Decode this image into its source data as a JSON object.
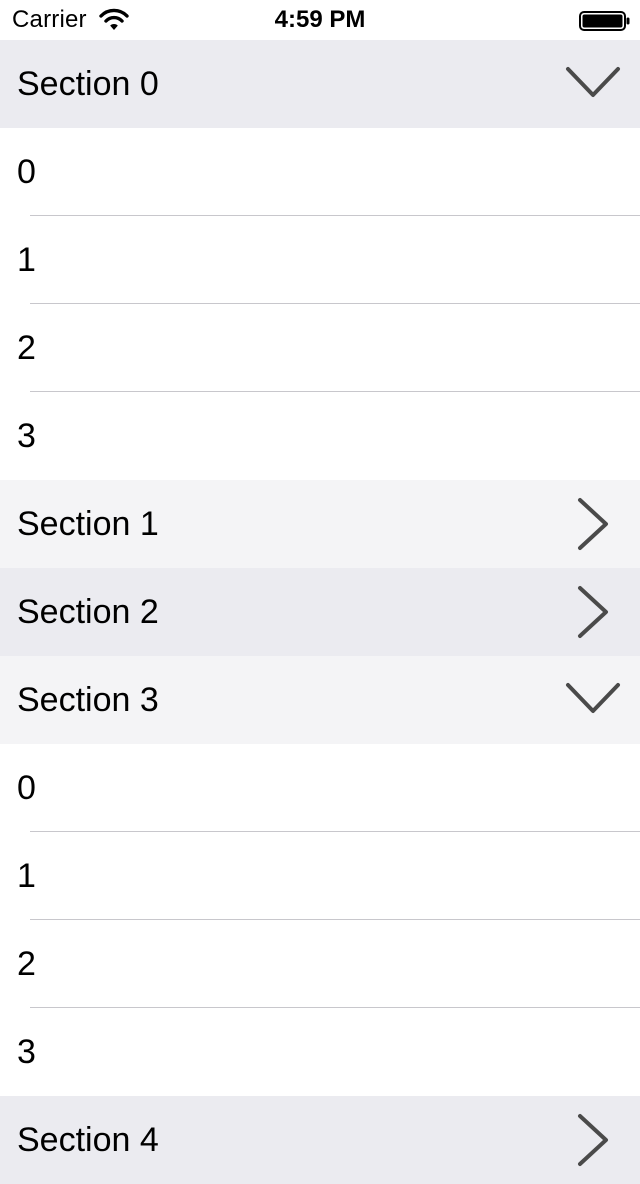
{
  "status_bar": {
    "carrier": "Carrier",
    "time": "4:59 PM",
    "wifi_icon": "wifi-icon",
    "battery_icon": "battery-icon"
  },
  "colors": {
    "header_shade_a": "#ebebf0",
    "header_shade_b": "#f4f4f6",
    "chevron": "#4a4a4a",
    "separator": "#c8c7cc"
  },
  "sections": [
    {
      "title": "Section 0",
      "expanded": true,
      "chevron_icon": "chevron-down-icon",
      "rows": [
        "0",
        "1",
        "2",
        "3"
      ]
    },
    {
      "title": "Section 1",
      "expanded": false,
      "chevron_icon": "chevron-right-icon",
      "rows": []
    },
    {
      "title": "Section 2",
      "expanded": false,
      "chevron_icon": "chevron-right-icon",
      "rows": []
    },
    {
      "title": "Section 3",
      "expanded": true,
      "chevron_icon": "chevron-down-icon",
      "rows": [
        "0",
        "1",
        "2",
        "3"
      ]
    },
    {
      "title": "Section 4",
      "expanded": false,
      "chevron_icon": "chevron-right-icon",
      "rows": []
    }
  ]
}
